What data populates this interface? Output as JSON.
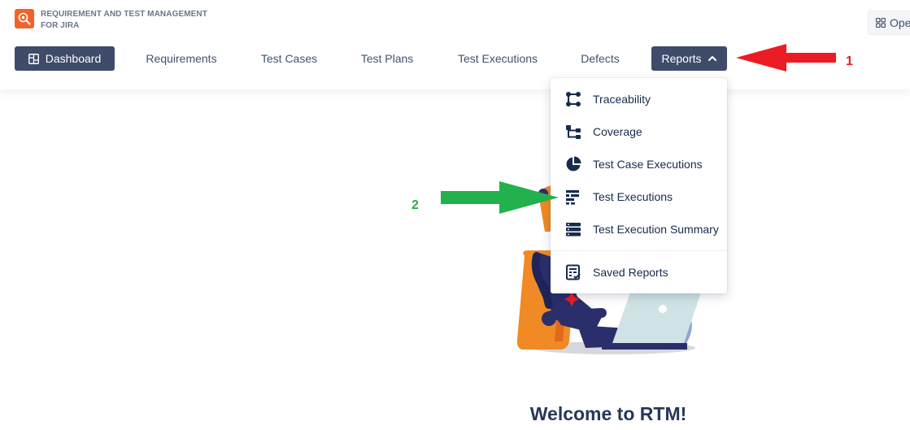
{
  "app": {
    "title": "REQUIREMENT AND TEST MANAGEMENT FOR JIRA",
    "open_label": "Ope"
  },
  "nav": {
    "dashboard": "Dashboard",
    "requirements": "Requirements",
    "test_cases": "Test Cases",
    "test_plans": "Test Plans",
    "test_executions": "Test Executions",
    "defects": "Defects",
    "reports": "Reports"
  },
  "reports_menu": {
    "items": [
      {
        "label": "Traceability",
        "icon": "traceability-icon"
      },
      {
        "label": "Coverage",
        "icon": "coverage-icon"
      },
      {
        "label": "Test Case Executions",
        "icon": "pie-chart-icon"
      },
      {
        "label": "Test Executions",
        "icon": "bars-icon"
      },
      {
        "label": "Test Execution Summary",
        "icon": "list-icon"
      },
      {
        "label": "Saved Reports",
        "icon": "saved-report-icon"
      }
    ]
  },
  "annotations": {
    "step_1": "1",
    "step_2": "2"
  },
  "main": {
    "welcome": "Welcome to RTM!"
  },
  "colors": {
    "nav_active_bg": "#3e4b6a",
    "brand": "#f0632a",
    "arrow_red": "#ec1c24",
    "arrow_green": "#22b14c"
  }
}
